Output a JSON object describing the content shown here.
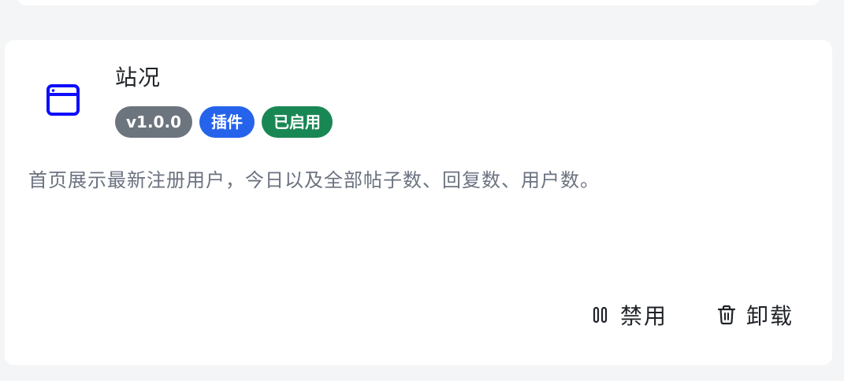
{
  "plugin": {
    "name": "站况",
    "icon": "browser-window-icon",
    "icon_color": "#0d0dff",
    "badges": {
      "version": "v1.0.0",
      "type": "插件",
      "status": "已启用"
    },
    "badge_colors": {
      "version": "#6c747e",
      "type": "#2563eb",
      "status": "#198754"
    },
    "description": "首页展示最新注册用户，今日以及全部帖子数、回复数、用户数。"
  },
  "actions": {
    "disable": {
      "label": "禁用",
      "icon": "pause-icon"
    },
    "uninstall": {
      "label": "卸载",
      "icon": "trash-icon"
    }
  }
}
